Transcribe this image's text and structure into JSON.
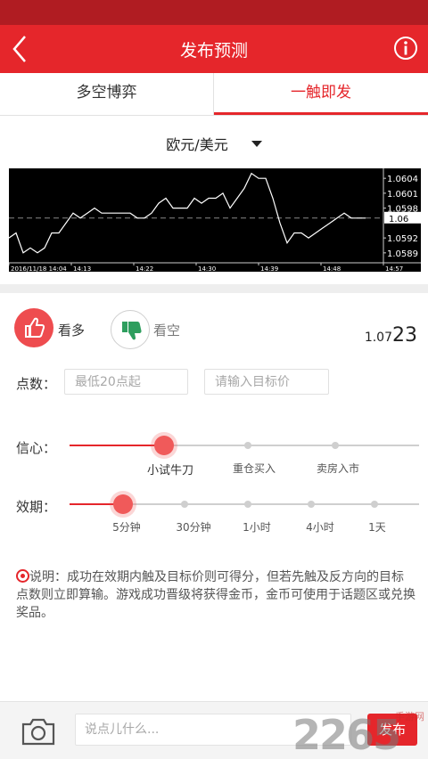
{
  "header": {
    "title": "发布预测"
  },
  "tabs": [
    {
      "label": "多空博弈",
      "active": false
    },
    {
      "label": "一触即发",
      "active": true
    }
  ],
  "pair": {
    "label": "欧元/美元"
  },
  "chart_data": {
    "type": "line",
    "x": [
      "2016/11/18 14:04",
      "14:13",
      "14:22",
      "14:30",
      "14:39",
      "14:48",
      "14:57"
    ],
    "x_tick_labels": [
      "2016/11/18 14:04",
      "14:13",
      "14:22",
      "14:30",
      "14:39",
      "14:48",
      "14:57"
    ],
    "y_tick_labels": [
      "1.0604",
      "1.0601",
      "1.0598",
      "1.0592",
      "1.0589"
    ],
    "current_value_label": "1.06",
    "reference_line": 1.0596,
    "ylim": [
      1.0587,
      1.0606
    ],
    "series": [
      {
        "values": [
          1.0592,
          1.0593,
          1.0589,
          1.059,
          1.0589,
          1.059,
          1.0593,
          1.0593,
          1.0595,
          1.0597,
          1.0596,
          1.0597,
          1.0598,
          1.0597,
          1.0597,
          1.0597,
          1.0597,
          1.0597,
          1.0596,
          1.0596,
          1.0597,
          1.0599,
          1.06,
          1.0598,
          1.0598,
          1.0598,
          1.06,
          1.0599,
          1.06,
          1.06,
          1.0601,
          1.0598,
          1.06,
          1.0602,
          1.0605,
          1.0604,
          1.0604,
          1.06,
          1.0595,
          1.0591,
          1.0593,
          1.0593,
          1.0592,
          1.0593,
          1.0594,
          1.0595,
          1.0596,
          1.0597,
          1.0596,
          1.0596,
          1.0596
        ]
      }
    ],
    "colors": {
      "background": "#000000",
      "line": "#ffffff",
      "reference": "#888888"
    }
  },
  "opinion": {
    "bull_label": "看多",
    "bear_label": "看空",
    "price_prefix": "1.07",
    "price_suffix": "23"
  },
  "points": {
    "label": "点数：",
    "min_placeholder": "最低20点起",
    "target_placeholder": "请输入目标价"
  },
  "confidence": {
    "label": "信心：",
    "options": [
      "小试牛刀",
      "重仓买入",
      "卖房入市"
    ],
    "selected_index": 0
  },
  "duration": {
    "label": "效期：",
    "options": [
      "5分钟",
      "30分钟",
      "1小时",
      "4小时",
      "1天"
    ],
    "selected_index": 0
  },
  "note": {
    "text": "说明：成功在效期内触及目标价则可得分，但若先触及反方向的目标点数则立即算输。游戏成功晋级将获得金币，金币可使用于话题区或兑换奖品。"
  },
  "bottom": {
    "comment_placeholder": "说点儿什么...",
    "publish_label": "发布"
  },
  "watermark": {
    "number": "2265",
    "site": "手游网"
  },
  "colors": {
    "brand": "#e5262b",
    "status_bar": "#b01c22"
  }
}
